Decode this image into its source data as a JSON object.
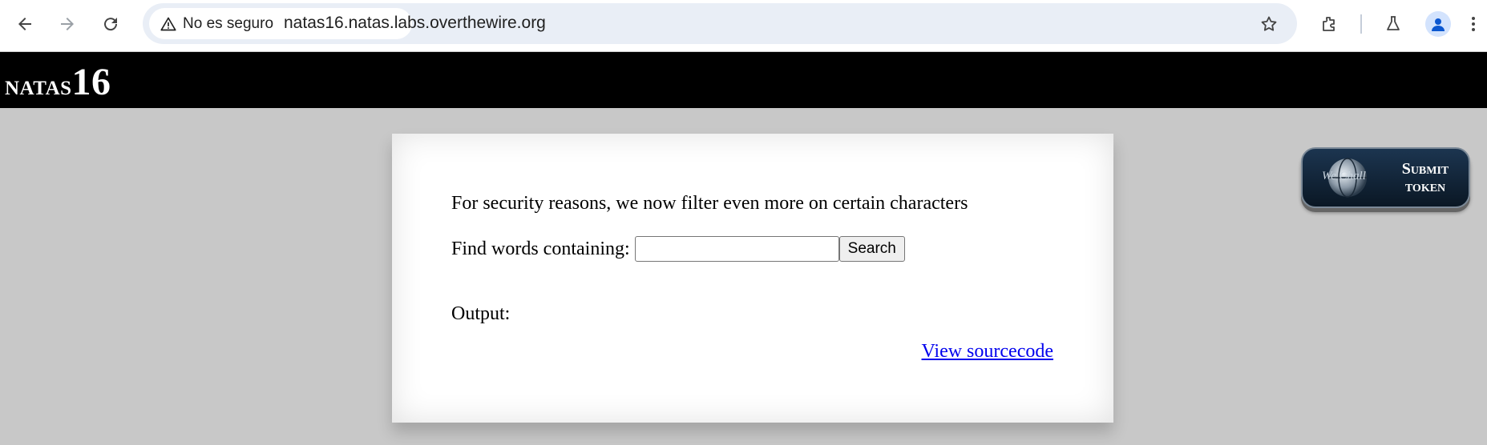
{
  "browser": {
    "security_label": "No es seguro",
    "url": "natas16.natas.labs.overthewire.org"
  },
  "header": {
    "title_prefix": "natas",
    "title_number": "16"
  },
  "content": {
    "message": "For security reasons, we now filter even more on certain characters",
    "search_label": "Find words containing:",
    "search_value": "",
    "search_button": "Search",
    "output_label": "Output:",
    "source_link": "View sourcecode"
  },
  "wechall": {
    "logo_text": "We Chall",
    "submit_line1": "Submit",
    "submit_line2": "token"
  }
}
